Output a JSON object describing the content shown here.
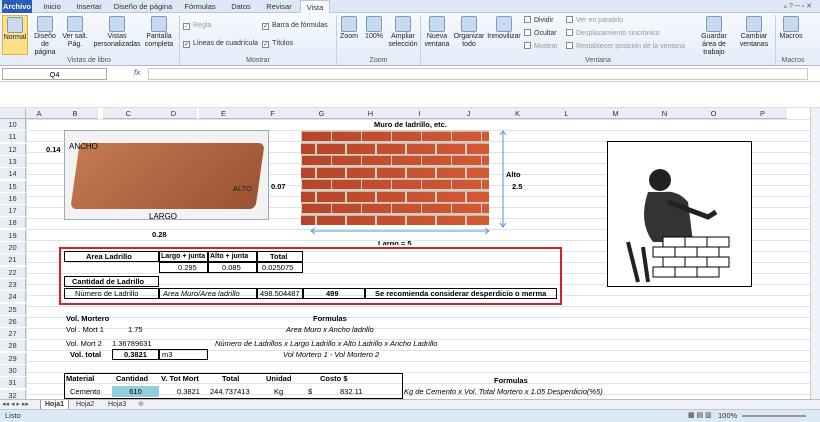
{
  "tabs": [
    "Archivo",
    "Inicio",
    "Insertar",
    "Diseño de página",
    "Fórmulas",
    "Datos",
    "Revisar",
    "Vista"
  ],
  "ribbon": {
    "vistas_libro": {
      "label": "Vistas de libro",
      "buttons": [
        "Normal",
        "Diseño de página",
        "Ver salt. Pág.",
        "Vistas personalizadas",
        "Pantalla completa"
      ]
    },
    "mostrar": {
      "label": "Mostrar",
      "checks": [
        {
          "text": "Regla",
          "checked": true,
          "disabled": true
        },
        {
          "text": "Líneas de cuadrícula",
          "checked": true
        },
        {
          "text": "Barra de fórmulas",
          "checked": true
        },
        {
          "text": "Títulos",
          "checked": true
        }
      ]
    },
    "zoom": {
      "label": "Zoom",
      "buttons": [
        "Zoom",
        "100%",
        "Ampliar selección"
      ]
    },
    "ventana": {
      "label": "Ventana",
      "buttons": [
        "Nueva ventana",
        "Organizar todo",
        "Inmovilizar"
      ],
      "small": [
        "Dividir",
        "Ocultar",
        "Mostrar"
      ],
      "small2": [
        "Ver en paralelo",
        "Desplazamiento sincrónico",
        "Restablecer posición de la ventana"
      ],
      "buttons2": [
        "Guardar área de trabajo",
        "Cambiar ventanas"
      ]
    },
    "macros": {
      "label": "Macros",
      "buttons": [
        "Macros"
      ]
    }
  },
  "namebox": "Q4",
  "fx": "fx",
  "columns": [
    "A",
    "B",
    "C",
    "D",
    "E",
    "F",
    "G",
    "H",
    "I",
    "J",
    "K",
    "L",
    "M",
    "N",
    "O",
    "P"
  ],
  "rows": [
    "10",
    "11",
    "12",
    "13",
    "14",
    "15",
    "16",
    "17",
    "18",
    "19",
    "20",
    "21",
    "22",
    "23",
    "24",
    "25",
    "26",
    "27",
    "28",
    "29",
    "30",
    "31",
    "32"
  ],
  "cells": {
    "muro_title": "Muro de ladrillo, etc.",
    "ancho_val": "0.14",
    "ancho": "ANCHO",
    "alto": "ALTO",
    "largo": "LARGO",
    "alto_side": "0.07",
    "largo_val": "0.28",
    "alto_label": "Alto",
    "alto_muro": "2.5",
    "largo_muro": "Largo = 5",
    "area_ladrillo": "Area Ladrillo",
    "largo_junta": "Largo + junta",
    "alto_junta": "Alto + junta",
    "total": "Total",
    "v_largo": "0.295",
    "v_alto": "0.085",
    "v_total": "0.025075",
    "cantidad_ladrillo": "Cantidad de Ladrillo",
    "numero_ladrillo": "Número de Ladrillo",
    "formula_area": "Area Muro/Area ladrillo",
    "v_num": "498.504487",
    "v_499": "499",
    "recomend": "Se recomienda considerar desperdicio o merma",
    "vol_mortero": "Vol. Mortero",
    "formulas": "Formulas",
    "vol_mort1": "Vol . Mort 1",
    "v_m1": "1.75",
    "f_m1": "Area Muro x Ancho ladrillo",
    "vol_mort2": "Vol.  Mort 2",
    "v_m2": "1.36789631",
    "f_m2": "Número de Ladrillos x Largo Ladrillo x Alto Ladrillo x Ancho Ladrillo",
    "vol_total": "Vol. total",
    "v_vt": "0.3821",
    "m3": "m3",
    "f_vt": "Vol Mortero 1 - Vol Mortero 2",
    "material": "Material",
    "cantidad": "Cantidad",
    "vtot": "V. Tot Mort",
    "total2": "Total",
    "unidad": "Unidad",
    "costo": "Costo $",
    "formulas2": "Formulas",
    "cemento": "Cemento",
    "v_610": "610",
    "v_03821": "0.3821",
    "v_244": "244.737413",
    "kg": "Kg",
    "dollar": "$",
    "v_832": "832.11",
    "f_cem": "Kg de Cemento x Vol. Total Mortero x 1.05 Desperdicio(%5)"
  },
  "sheets": [
    "Hoja1",
    "Hoja2",
    "Hoja3"
  ],
  "status": {
    "ready": "Listo",
    "zoom": "100%"
  }
}
